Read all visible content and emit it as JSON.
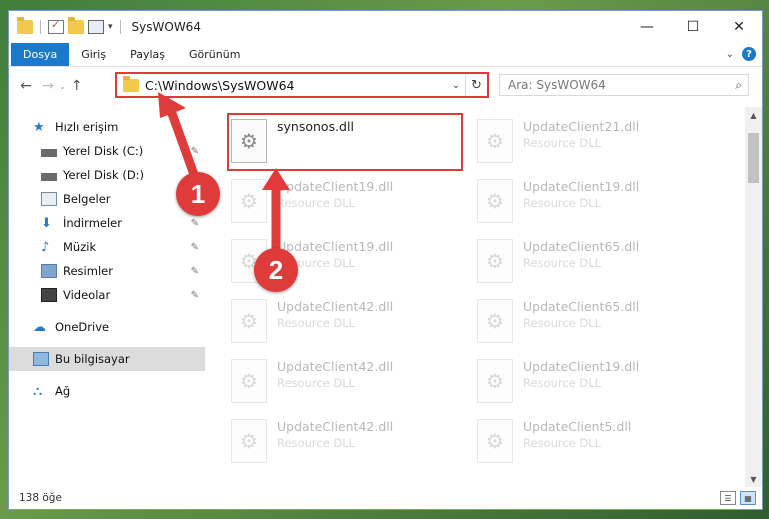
{
  "window": {
    "title": "SysWOW64",
    "controls": {
      "minimize": "—",
      "maximize": "☐",
      "close": "✕"
    }
  },
  "ribbon": {
    "tabs": [
      "Dosya",
      "Giriş",
      "Paylaş",
      "Görünüm"
    ],
    "expand_icon": "chevron-down-icon",
    "help": "?"
  },
  "address": {
    "back": "←",
    "forward": "→",
    "up": "↑",
    "path": "C:\\Windows\\SysWOW64",
    "dropdown": "⌄",
    "refresh": "↻"
  },
  "search": {
    "placeholder": "Ara: SysWOW64",
    "icon": "⌕"
  },
  "nav": {
    "items": [
      {
        "label": "Hızlı erişim",
        "icon": "star-icon",
        "pinned": false
      },
      {
        "label": "Yerel Disk (C:)",
        "icon": "drive-icon",
        "pinned": true
      },
      {
        "label": "Yerel Disk (D:)",
        "icon": "drive-icon",
        "pinned": true
      },
      {
        "label": "Belgeler",
        "icon": "documents-icon",
        "pinned": true
      },
      {
        "label": "İndirmeler",
        "icon": "download-icon",
        "pinned": true
      },
      {
        "label": "Müzik",
        "icon": "music-icon",
        "pinned": true
      },
      {
        "label": "Resimler",
        "icon": "pictures-icon",
        "pinned": true
      },
      {
        "label": "Videolar",
        "icon": "videos-icon",
        "pinned": true
      },
      {
        "label": "OneDrive",
        "icon": "cloud-icon",
        "pinned": false
      },
      {
        "label": "Bu bilgisayar",
        "icon": "computer-icon",
        "pinned": false
      },
      {
        "label": "Ağ",
        "icon": "network-icon",
        "pinned": false
      }
    ],
    "pin_glyph": "📌"
  },
  "files": {
    "col1": [
      {
        "name": "synsonos.dll",
        "type": ""
      },
      {
        "name": "UpdateClient19.dll",
        "type": "Resource DLL"
      },
      {
        "name": "UpdateClient19.dll",
        "type": "Resource DLL"
      },
      {
        "name": "UpdateClient42.dll",
        "type": "Resource DLL"
      },
      {
        "name": "UpdateClient42.dll",
        "type": "Resource DLL"
      },
      {
        "name": "UpdateClient42.dll",
        "type": "Resource DLL"
      }
    ],
    "col2": [
      {
        "name": "UpdateClient21.dll",
        "type": "Resource DLL"
      },
      {
        "name": "UpdateClient19.dll",
        "type": "Resource DLL"
      },
      {
        "name": "UpdateClient65.dll",
        "type": "Resource DLL"
      },
      {
        "name": "UpdateClient65.dll",
        "type": "Resource DLL"
      },
      {
        "name": "UpdateClient19.dll",
        "type": "Resource DLL"
      },
      {
        "name": "UpdateClient5.dll",
        "type": "Resource DLL"
      }
    ]
  },
  "status": {
    "count": "138 öğe"
  },
  "annotations": {
    "step1": "1",
    "step2": "2",
    "color": "#e03b3b"
  }
}
